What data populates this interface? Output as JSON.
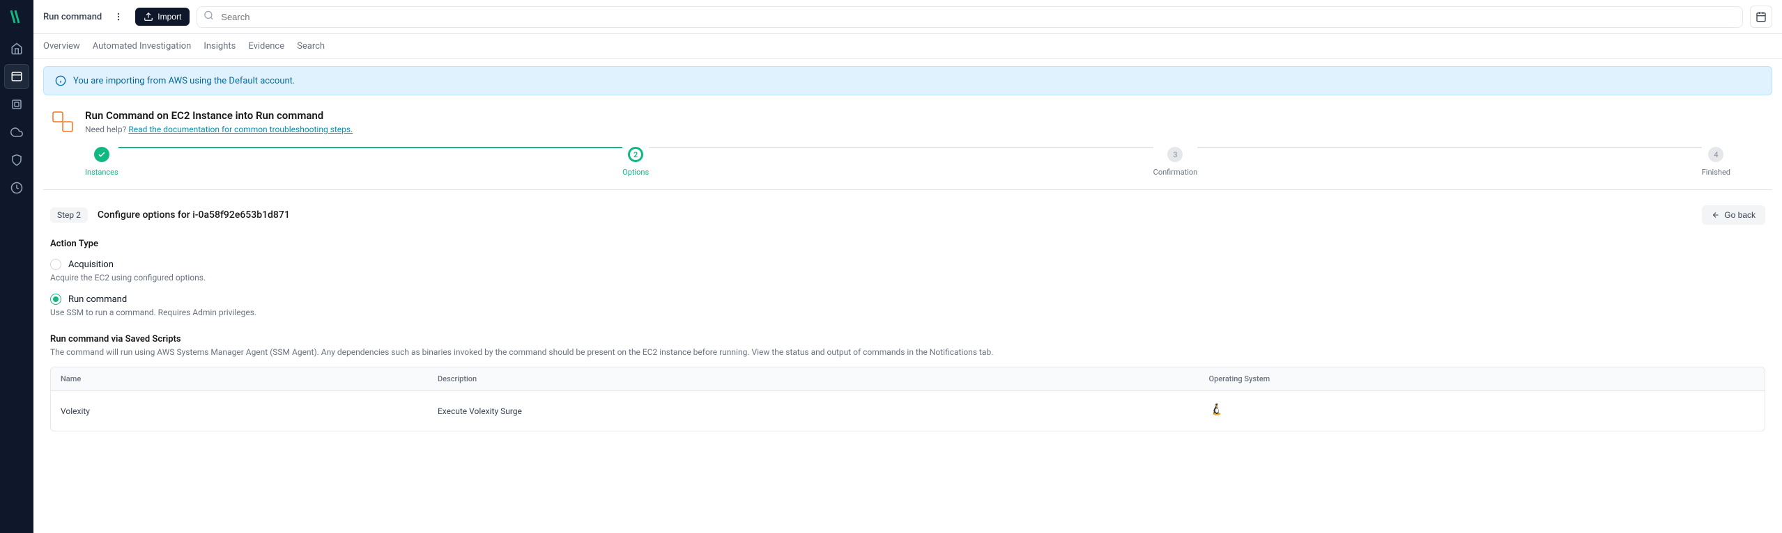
{
  "sidebar": {
    "items": [
      {
        "name": "home"
      },
      {
        "name": "investigations"
      },
      {
        "name": "evidence"
      },
      {
        "name": "cloud"
      },
      {
        "name": "security"
      },
      {
        "name": "time"
      }
    ]
  },
  "topbar": {
    "breadcrumb": "Run command",
    "import_label": "Import",
    "search_placeholder": "Search"
  },
  "tabs": [
    {
      "label": "Overview"
    },
    {
      "label": "Automated Investigation"
    },
    {
      "label": "Insights"
    },
    {
      "label": "Evidence"
    },
    {
      "label": "Search"
    }
  ],
  "banner": {
    "text": "You are importing from AWS using the Default account."
  },
  "header": {
    "title": "Run Command on EC2 Instance into Run command",
    "help_prefix": "Need help? ",
    "help_link": "Read the documentation for common troubleshooting steps."
  },
  "stepper": [
    {
      "label": "Instances",
      "state": "done"
    },
    {
      "label": "Options",
      "num": "2",
      "state": "current"
    },
    {
      "label": "Confirmation",
      "num": "3",
      "state": "pending"
    },
    {
      "label": "Finished",
      "num": "4",
      "state": "pending"
    }
  ],
  "content": {
    "step_badge": "Step 2",
    "title": "Configure options for i-0a58f92e653b1d871",
    "goback": "Go back",
    "action_type_title": "Action Type",
    "radios": [
      {
        "label": "Acquisition",
        "desc": "Acquire the EC2 using configured options.",
        "selected": false
      },
      {
        "label": "Run command",
        "desc": "Use SSM to run a command. Requires Admin privileges.",
        "selected": true
      }
    ],
    "scripts_title": "Run command via Saved Scripts",
    "scripts_desc": "The command will run using AWS Systems Manager Agent (SSM Agent). Any dependencies such as binaries invoked by the command should be present on the EC2 instance before running. View the status and output of commands in the Notifications tab.",
    "table": {
      "headers": {
        "name": "Name",
        "desc": "Description",
        "os": "Operating System"
      },
      "rows": [
        {
          "name": "Volexity",
          "desc": "Execute Volexity Surge",
          "os": "linux"
        }
      ]
    }
  }
}
